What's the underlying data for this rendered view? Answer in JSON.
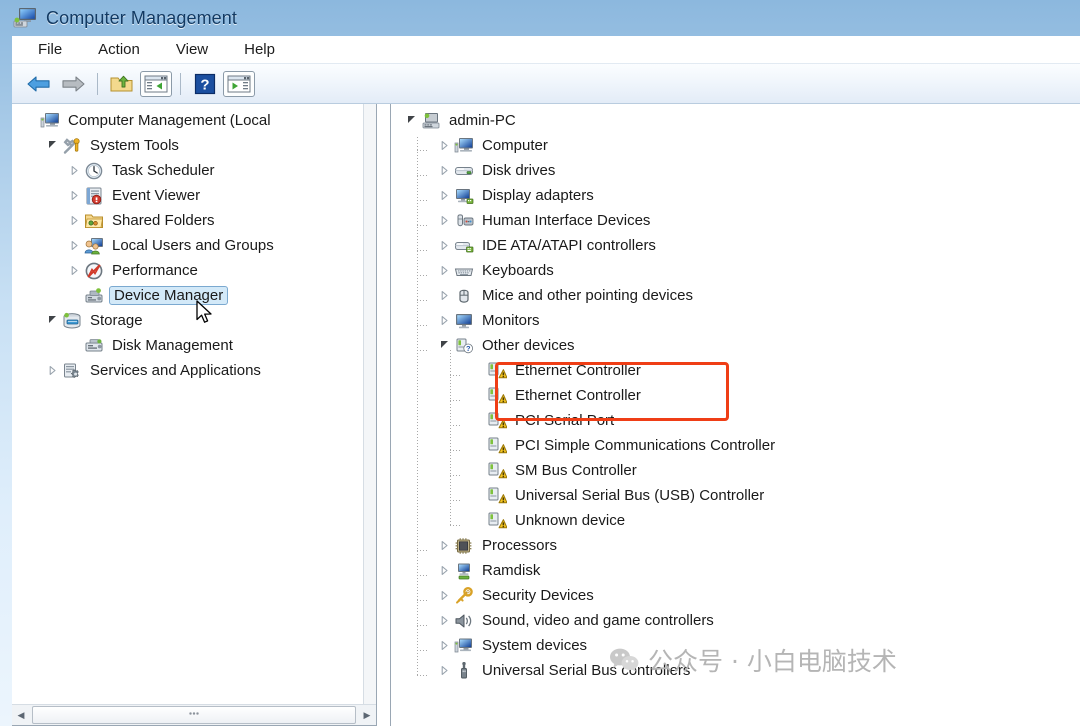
{
  "window": {
    "title": "Computer Management",
    "title_icon": "computer-icon"
  },
  "menubar": {
    "items": [
      {
        "label": "File",
        "name": "menu-file"
      },
      {
        "label": "Action",
        "name": "menu-action"
      },
      {
        "label": "View",
        "name": "menu-view"
      },
      {
        "label": "Help",
        "name": "menu-help"
      }
    ]
  },
  "toolbar": {
    "buttons": [
      {
        "name": "back-arrow-icon",
        "icon": "arrow-left"
      },
      {
        "name": "forward-arrow-icon",
        "icon": "arrow-right"
      },
      {
        "name": "up-one-level-icon",
        "icon": "folder-up"
      },
      {
        "name": "show-hide-console-tree-icon",
        "icon": "tree-panel"
      },
      {
        "name": "help-icon",
        "icon": "question"
      },
      {
        "name": "show-hide-action-pane-icon",
        "icon": "action-pane"
      }
    ]
  },
  "left_tree": {
    "nodes": [
      {
        "label": "Computer Management (Local",
        "level": 0,
        "state": "none",
        "icon": "computer-icon",
        "selected": false
      },
      {
        "label": "System Tools",
        "level": 1,
        "state": "open",
        "icon": "system-tools-icon",
        "selected": false
      },
      {
        "label": "Task Scheduler",
        "level": 2,
        "state": "closed",
        "icon": "clock-icon",
        "selected": false
      },
      {
        "label": "Event Viewer",
        "level": 2,
        "state": "closed",
        "icon": "event-viewer-icon",
        "selected": false
      },
      {
        "label": "Shared Folders",
        "level": 2,
        "state": "closed",
        "icon": "shared-folders-icon",
        "selected": false
      },
      {
        "label": "Local Users and Groups",
        "level": 2,
        "state": "closed",
        "icon": "users-icon",
        "selected": false
      },
      {
        "label": "Performance",
        "level": 2,
        "state": "closed",
        "icon": "performance-icon",
        "selected": false
      },
      {
        "label": "Device Manager",
        "level": 2,
        "state": "none",
        "icon": "device-manager-icon",
        "selected": true
      },
      {
        "label": "Storage",
        "level": 1,
        "state": "open",
        "icon": "storage-icon",
        "selected": false
      },
      {
        "label": "Disk Management",
        "level": 2,
        "state": "none",
        "icon": "disk-management-icon",
        "selected": false
      },
      {
        "label": "Services and Applications",
        "level": 1,
        "state": "closed",
        "icon": "services-icon",
        "selected": false
      }
    ]
  },
  "right_tree": {
    "nodes": [
      {
        "label": "admin-PC",
        "level": 0,
        "state": "open",
        "icon": "pc-icon",
        "warn": false
      },
      {
        "label": "Computer",
        "level": 1,
        "state": "closed",
        "icon": "computer-icon",
        "warn": false
      },
      {
        "label": "Disk drives",
        "level": 1,
        "state": "closed",
        "icon": "disk-drive-icon",
        "warn": false
      },
      {
        "label": "Display adapters",
        "level": 1,
        "state": "closed",
        "icon": "display-icon",
        "warn": false
      },
      {
        "label": "Human Interface Devices",
        "level": 1,
        "state": "closed",
        "icon": "hid-icon",
        "warn": false
      },
      {
        "label": "IDE ATA/ATAPI controllers",
        "level": 1,
        "state": "closed",
        "icon": "ide-icon",
        "warn": false
      },
      {
        "label": "Keyboards",
        "level": 1,
        "state": "closed",
        "icon": "keyboard-icon",
        "warn": false
      },
      {
        "label": "Mice and other pointing devices",
        "level": 1,
        "state": "closed",
        "icon": "mouse-icon",
        "warn": false
      },
      {
        "label": "Monitors",
        "level": 1,
        "state": "closed",
        "icon": "monitor-icon",
        "warn": false
      },
      {
        "label": "Other devices",
        "level": 1,
        "state": "open",
        "icon": "unknown-group-icon",
        "warn": false
      },
      {
        "label": "Ethernet Controller",
        "level": 2,
        "state": "none",
        "icon": "unknown-device-icon",
        "warn": true
      },
      {
        "label": "Ethernet Controller",
        "level": 2,
        "state": "none",
        "icon": "unknown-device-icon",
        "warn": true
      },
      {
        "label": "PCI Serial Port",
        "level": 2,
        "state": "none",
        "icon": "unknown-device-icon",
        "warn": true
      },
      {
        "label": "PCI Simple Communications Controller",
        "level": 2,
        "state": "none",
        "icon": "unknown-device-icon",
        "warn": true
      },
      {
        "label": "SM Bus Controller",
        "level": 2,
        "state": "none",
        "icon": "unknown-device-icon",
        "warn": true
      },
      {
        "label": "Universal Serial Bus (USB) Controller",
        "level": 2,
        "state": "none",
        "icon": "unknown-device-icon",
        "warn": true
      },
      {
        "label": "Unknown device",
        "level": 2,
        "state": "none",
        "icon": "unknown-device-icon",
        "warn": true
      },
      {
        "label": "Processors",
        "level": 1,
        "state": "closed",
        "icon": "processor-icon",
        "warn": false
      },
      {
        "label": "Ramdisk",
        "level": 1,
        "state": "closed",
        "icon": "ramdisk-icon",
        "warn": false
      },
      {
        "label": "Security Devices",
        "level": 1,
        "state": "closed",
        "icon": "key-icon",
        "warn": false
      },
      {
        "label": "Sound, video and game controllers",
        "level": 1,
        "state": "closed",
        "icon": "speaker-icon",
        "warn": false
      },
      {
        "label": "System devices",
        "level": 1,
        "state": "closed",
        "icon": "system-device-icon",
        "warn": false
      },
      {
        "label": "Universal Serial Bus controllers",
        "level": 1,
        "state": "closed",
        "icon": "usb-icon",
        "warn": false
      }
    ]
  },
  "highlight": {
    "name": "ethernet-controller-highlight",
    "color": "#ef3e16",
    "covers": [
      "Ethernet Controller",
      "Ethernet Controller"
    ]
  },
  "watermark": {
    "text": "公众号 · 小白电脑技术",
    "logo": "wechat-icon",
    "color": "#b5b5b5"
  },
  "scrollbars": {
    "left_horizontal_thumb": "grip-dots"
  }
}
